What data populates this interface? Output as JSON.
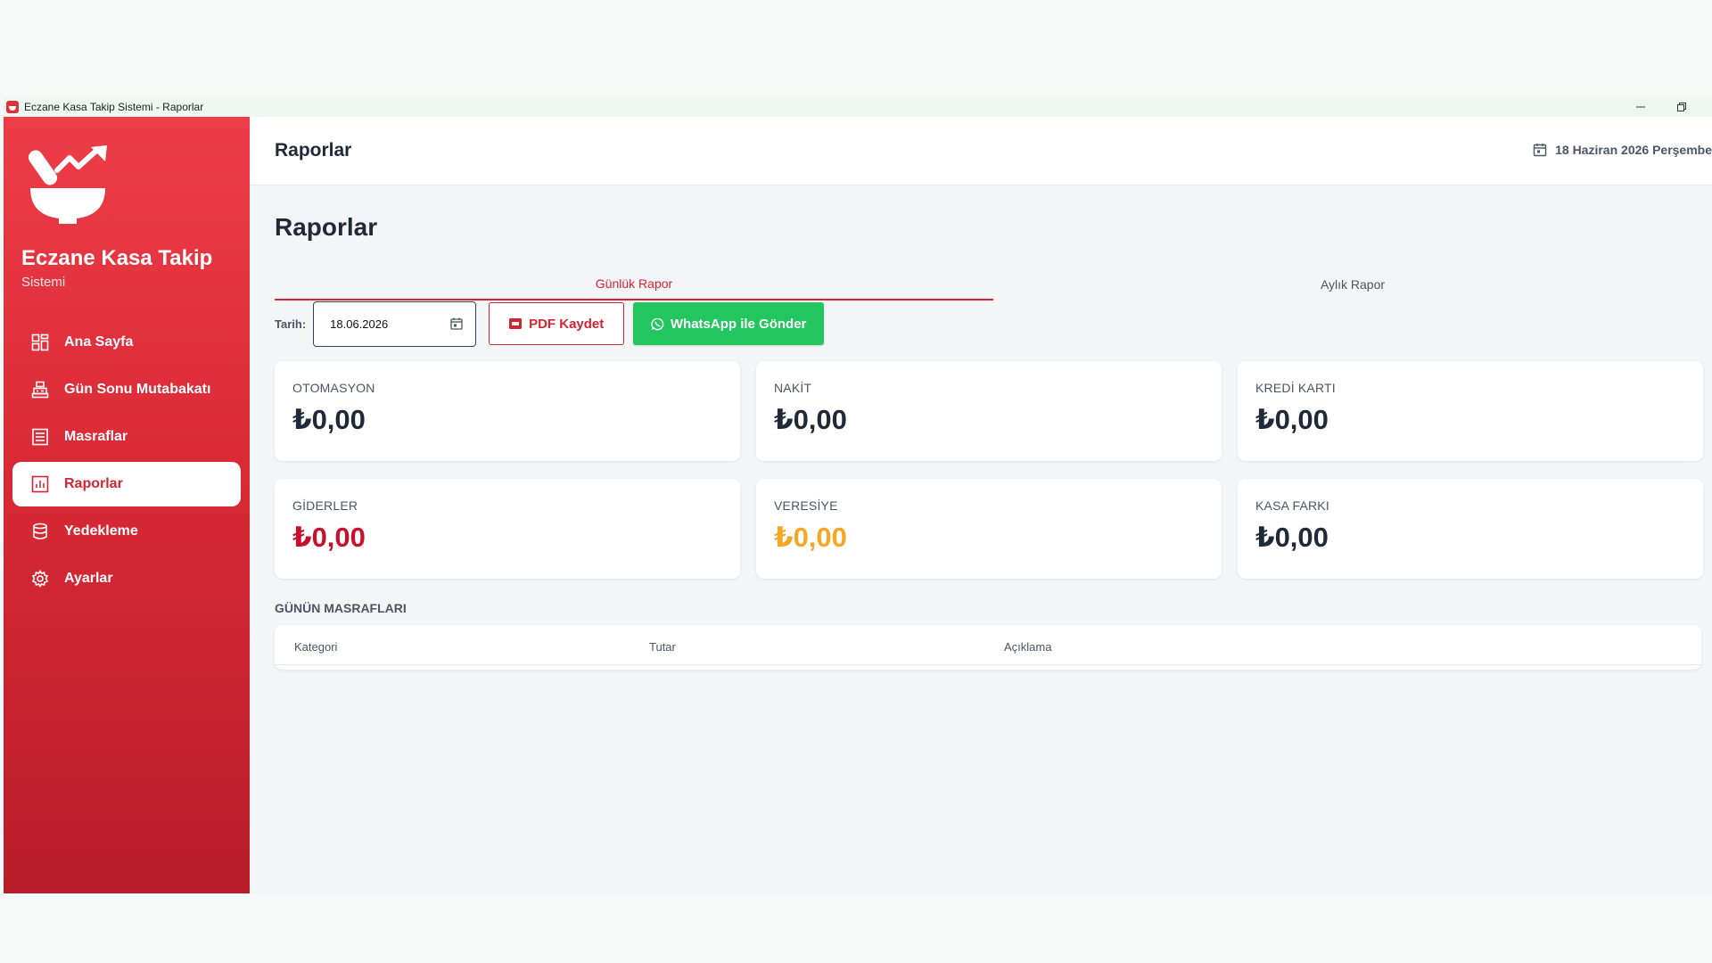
{
  "window": {
    "title": "Eczane Kasa Takip Sistemi  -  Raporlar"
  },
  "sidebar": {
    "brand_title": "Eczane Kasa Takip",
    "brand_subtitle": "Sistemi",
    "items": [
      {
        "label": "Ana Sayfa",
        "icon": "dashboard-icon"
      },
      {
        "label": "Gün Sonu Mutabakatı",
        "icon": "cash-register-icon"
      },
      {
        "label": "Masraflar",
        "icon": "list-icon"
      },
      {
        "label": "Raporlar",
        "icon": "chart-icon",
        "active": true
      },
      {
        "label": "Yedekleme",
        "icon": "database-icon"
      },
      {
        "label": "Ayarlar",
        "icon": "gear-icon"
      }
    ]
  },
  "topbar": {
    "title": "Raporlar",
    "date": "18 Haziran 2026 Perşembe"
  },
  "page": {
    "title": "Raporlar"
  },
  "tabs": [
    {
      "label": "Günlük Rapor",
      "active": true
    },
    {
      "label": "Aylık Rapor",
      "active": false
    }
  ],
  "filter": {
    "date_label": "Tarih:",
    "date_value": "18.06.2026",
    "pdf_label": "PDF Kaydet",
    "whatsapp_label": "WhatsApp ile Gönder"
  },
  "cards": [
    {
      "label": "OTOMASYON",
      "value": "₺0,00"
    },
    {
      "label": "NAKİT",
      "value": "₺0,00"
    },
    {
      "label": "KREDİ KARTI",
      "value": "₺0,00"
    },
    {
      "label": "GİDERLER",
      "value": "₺0,00"
    },
    {
      "label": "VERESİYE",
      "value": "₺0,00"
    },
    {
      "label": "KASA FARKI",
      "value": "₺0,00"
    }
  ],
  "expenses": {
    "title": "GÜNÜN MASRAFLARI",
    "columns": [
      "Kategori",
      "Tutar",
      "Açıklama"
    ]
  },
  "colors": {
    "brand": "#e0313b",
    "accent_red": "#d32531",
    "expense_red": "#c8102e",
    "credit_orange": "#f5a623",
    "whatsapp_green": "#22c55e"
  }
}
